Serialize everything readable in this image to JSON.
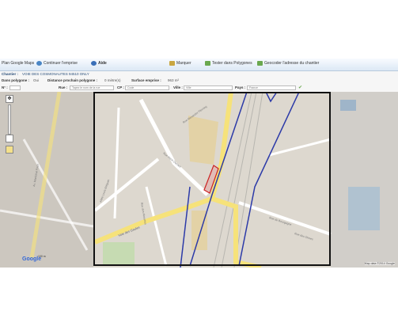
{
  "toolbar": {
    "map_tab": "Plan Google Maps",
    "continue": "Continuer l'emprise",
    "help": "Aide",
    "mark": "Marquer",
    "test": "Tester dans Polygones",
    "geocode": "Geocoder l'adresse du chantier"
  },
  "info": {
    "chantier_label": "Chantier :",
    "chantier_value": "VOIE DES COSMONAUTES 94510 ONLY",
    "polygon_label": "Dans polygone :",
    "polygon_value": "Oui",
    "distance_label": "Distance prochain polygone :",
    "distance_value": "0 mètre(s)",
    "surface_label": "Surface emprise :",
    "surface_value": "963 m²",
    "num_label": "N° :",
    "rue_label": "Rue :",
    "rue_placeholder": "Tapez le nom de la rue",
    "cp_label": "CP :",
    "cp_placeholder": "Code",
    "ville_label": "Ville :",
    "ville_placeholder": "Ville",
    "pays_label": "Pays :",
    "pays_placeholder": "France"
  },
  "map": {
    "streets": [
      "Av. Maréchal Foch",
      "Rue Alexander Fleming",
      "Rue Henri Dunant",
      "Allée Louis Bréguet",
      "Rue des Alouettes",
      "Voie des Gaules",
      "Rue de Bourgogne",
      "Rue des Ormes"
    ],
    "google_logo": "Google",
    "copyright": "Map data ©2014 Google",
    "scale": "100 m"
  },
  "colors": {
    "polygon": "#2c3aa8",
    "selection": "#cc2222",
    "road": "#f6e27a"
  }
}
